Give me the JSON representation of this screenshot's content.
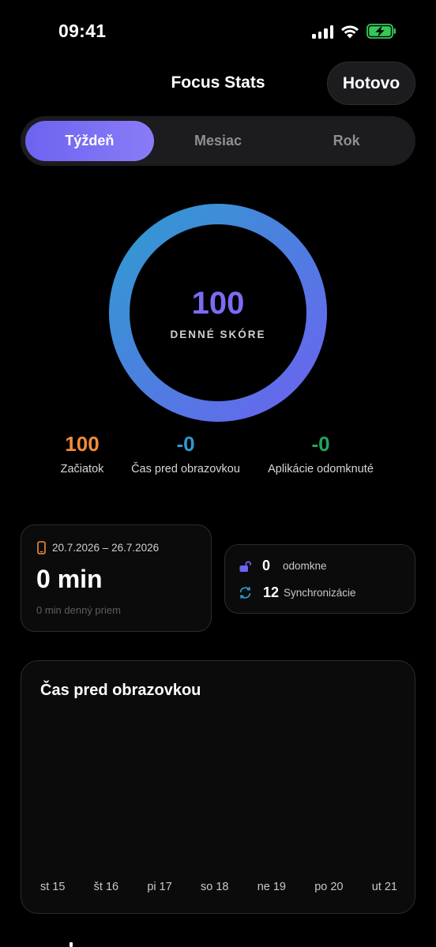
{
  "status_bar": {
    "time": "09:41"
  },
  "header": {
    "title": "Focus Stats",
    "done_label": "Hotovo"
  },
  "tabs": [
    {
      "label": "Týždeň",
      "active": true
    },
    {
      "label": "Mesiac",
      "active": false
    },
    {
      "label": "Rok",
      "active": false
    }
  ],
  "score": {
    "value": "100",
    "label": "DENNÉ SKÓRE",
    "progress": 1.0
  },
  "stats": [
    {
      "value": "100",
      "label": "Začiatok",
      "color": "#f28c38"
    },
    {
      "value": "-0",
      "label": "Čas pred obrazovkou",
      "color": "#2d9bd0"
    },
    {
      "value": "-0",
      "label": "Aplikácie odomknuté",
      "color": "#22a55f"
    }
  ],
  "week_card": {
    "range": "20.7.2026 – 26.7.2026",
    "total": "0 min",
    "average": "0 min denný priem"
  },
  "sync_card": {
    "unlocks_value": "0",
    "unlocks_label": "odomkne",
    "syncs_value": "12",
    "syncs_label": "Synchronizácie"
  },
  "chart_data": {
    "type": "bar",
    "title": "Čas pred obrazovkou",
    "categories": [
      "st 15",
      "št 16",
      "pi 17",
      "so 18",
      "ne 19",
      "po 20",
      "ut 21"
    ],
    "values": [
      0,
      0,
      0,
      0,
      0,
      0,
      0
    ]
  },
  "colors": {
    "accent": "#7b6cf4",
    "ring_start": "#2f9bd0",
    "ring_end": "#6b63f0",
    "battery": "#34c759"
  }
}
